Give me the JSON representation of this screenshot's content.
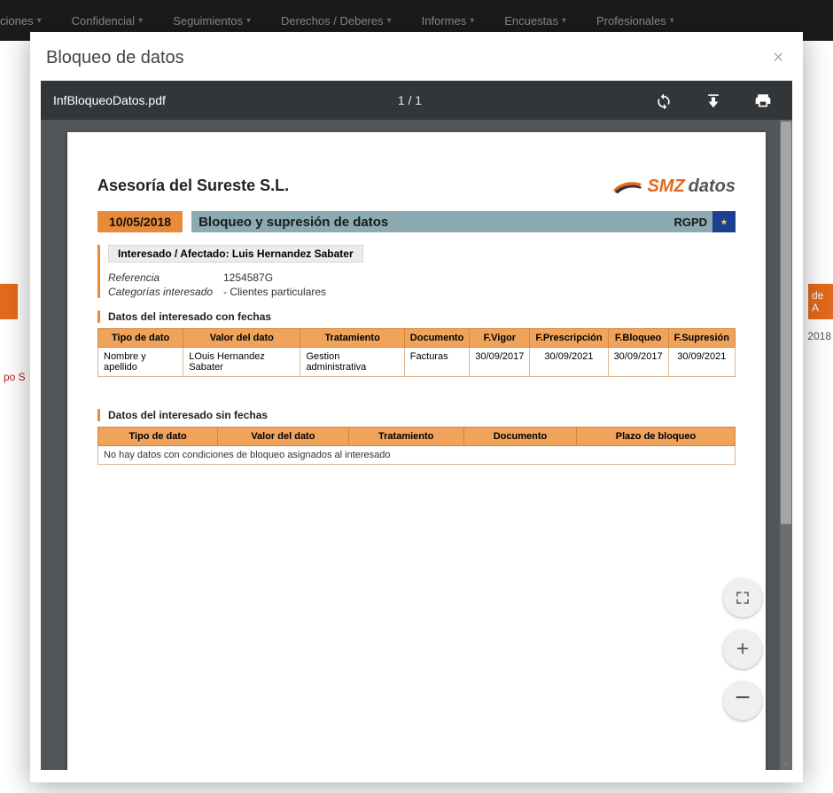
{
  "nav": {
    "items": [
      {
        "label": "ciones"
      },
      {
        "label": "Confidencial"
      },
      {
        "label": "Seguimientos"
      },
      {
        "label": "Derechos / Deberes"
      },
      {
        "label": "Informes"
      },
      {
        "label": "Encuestas"
      },
      {
        "label": "Profesionales"
      }
    ]
  },
  "bg": {
    "right_orange": "de A",
    "right_year": "2018",
    "left_red": "po S"
  },
  "modal": {
    "title": "Bloqueo de datos"
  },
  "toolbar": {
    "filename": "InfBloqueoDatos.pdf",
    "page_indicator": "1 / 1"
  },
  "doc": {
    "company": "Asesoría del Sureste S.L.",
    "logo": {
      "smz": "SMZ",
      "datos": "datos"
    },
    "date": "10/05/2018",
    "banner_title": "Bloqueo y supresión de datos",
    "banner_right": "RGPD",
    "chip_label": "Interesado / Afectado: Luis Hernandez Sabater",
    "ref_label": "Referencia",
    "ref_value": "1254587G",
    "cat_label": "Categorías interesado",
    "cat_value": "- Clientes particulares",
    "section1_title": "Datos del interesado con fechas",
    "table1": {
      "headers": [
        "Tipo de dato",
        "Valor del dato",
        "Tratamiento",
        "Documento",
        "F.Vigor",
        "F.Prescripción",
        "F.Bloqueo",
        "F.Supresión"
      ],
      "rows": [
        {
          "tipo": "Nombre y apellido",
          "valor": "LOuis Hernandez Sabater",
          "trat": "Gestion administrativa",
          "doc": "Facturas",
          "fvigor": "30/09/2017",
          "fpres": "30/09/2021",
          "fbloq": "30/09/2017",
          "fsup": "30/09/2021"
        }
      ]
    },
    "section2_title": "Datos del interesado sin fechas",
    "table2": {
      "headers": [
        "Tipo de dato",
        "Valor del dato",
        "Tratamiento",
        "Documento",
        "Plazo de bloqueo"
      ],
      "empty_message": "No hay datos con condiciones de bloqueo asignados al interesado"
    }
  }
}
